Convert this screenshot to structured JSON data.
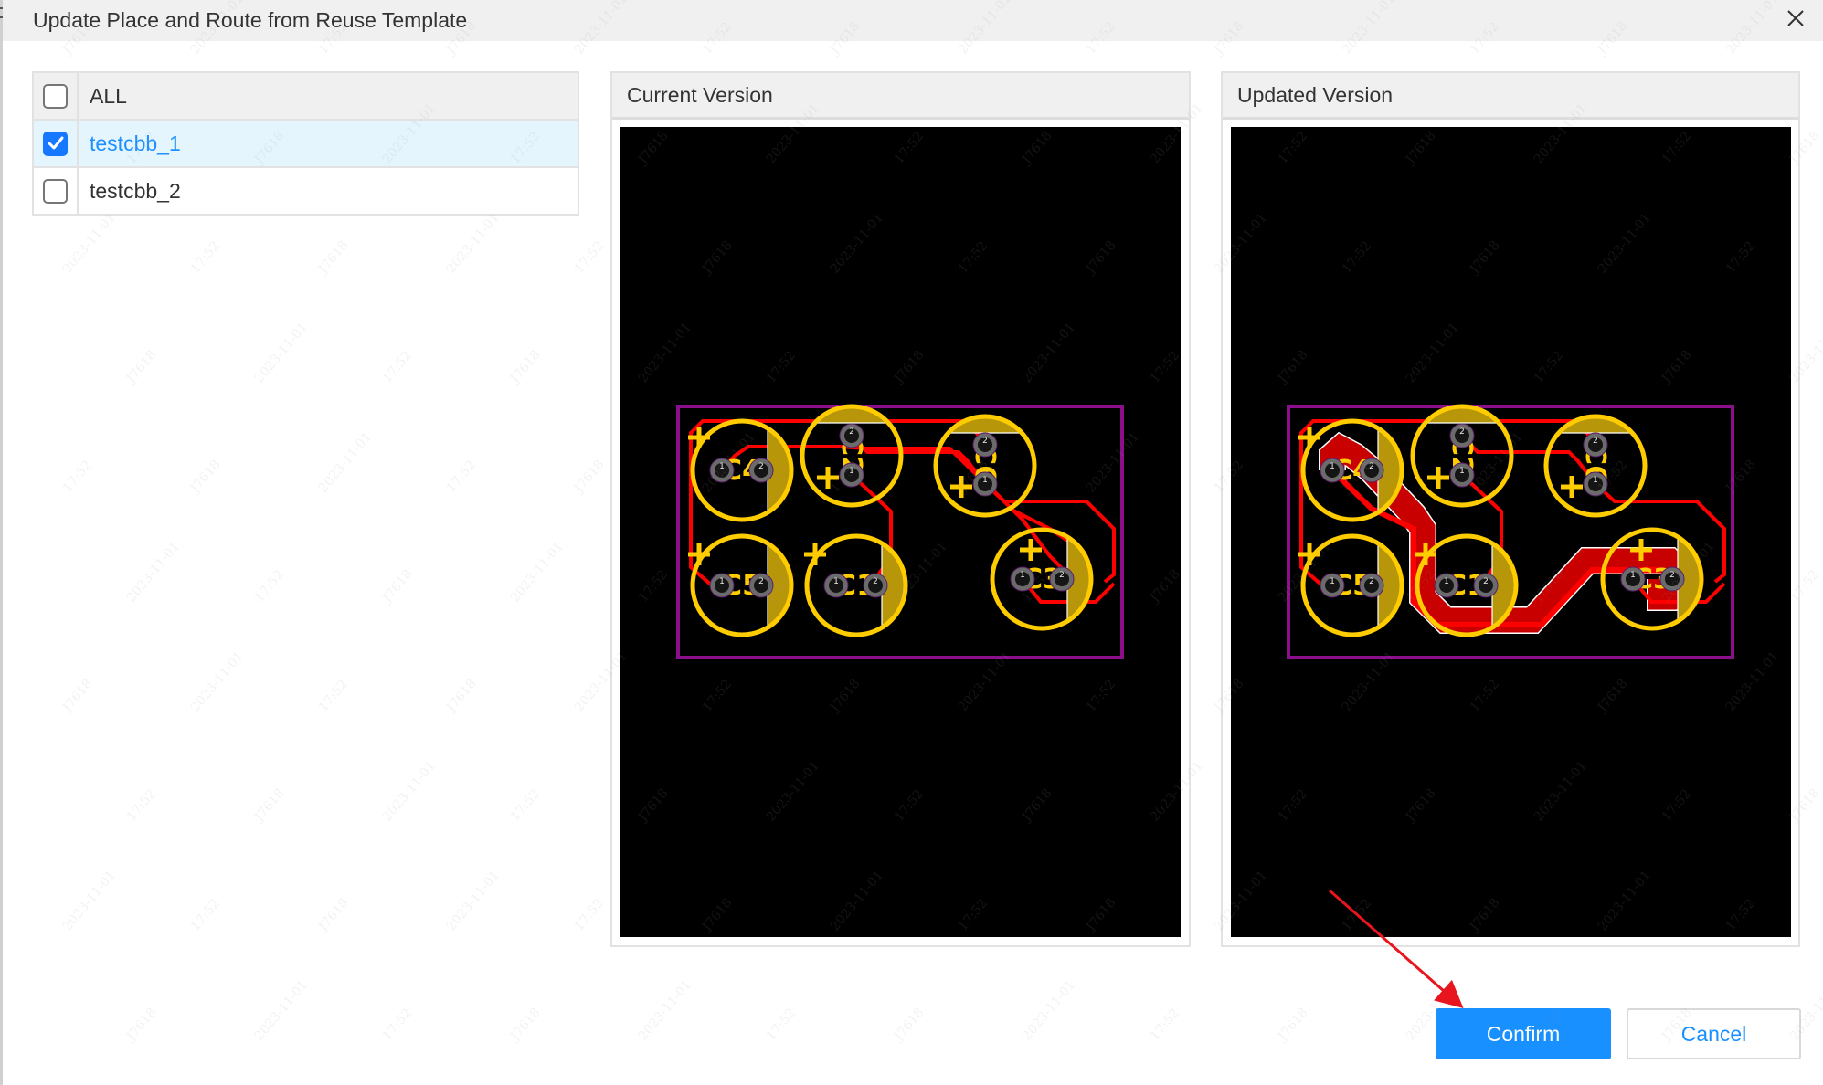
{
  "dialog": {
    "title": "Update Place and Route from Reuse Template",
    "close_icon": "close-icon"
  },
  "list": {
    "header": {
      "label": "ALL",
      "checked": false
    },
    "items": [
      {
        "label": "testcbb_1",
        "checked": true,
        "selected": true
      },
      {
        "label": "testcbb_2",
        "checked": false,
        "selected": false
      }
    ]
  },
  "panels": {
    "current": {
      "title": "Current Version"
    },
    "updated": {
      "title": "Updated Version"
    }
  },
  "pcb": {
    "colors": {
      "background": "#000000",
      "board_outline": "#8b0f8b",
      "silkscreen": "#ffcc00",
      "silk_fill": "#b8960a",
      "trace": "#ff0000",
      "trace_wide": "#c80000",
      "pad": "#6b6b6b",
      "pad_hole": "#151515",
      "pad_label": "#e8e8e8"
    },
    "components": [
      {
        "ref": "C4",
        "orientation": "horizontal",
        "pad_labels": [
          "1",
          "2"
        ]
      },
      {
        "ref": "C2",
        "orientation": "vertical",
        "pad_labels": [
          "1",
          "2"
        ]
      },
      {
        "ref": "C6",
        "orientation": "vertical",
        "pad_labels": [
          "1",
          "2"
        ]
      },
      {
        "ref": "C5",
        "orientation": "horizontal",
        "pad_labels": [
          "1",
          "2"
        ]
      },
      {
        "ref": "C1",
        "orientation": "horizontal",
        "pad_labels": [
          "1",
          "2"
        ]
      },
      {
        "ref": "C3",
        "orientation": "horizontal",
        "pad_labels": [
          "1",
          "2"
        ]
      }
    ]
  },
  "watermark": {
    "texts": [
      "J7618",
      "2023-11-01",
      "17:52"
    ],
    "color": "#9a9a9a"
  },
  "buttons": {
    "confirm": "Confirm",
    "cancel": "Cancel"
  },
  "annotation": {
    "arrow_color": "#e8141e",
    "target": "confirm-button"
  }
}
